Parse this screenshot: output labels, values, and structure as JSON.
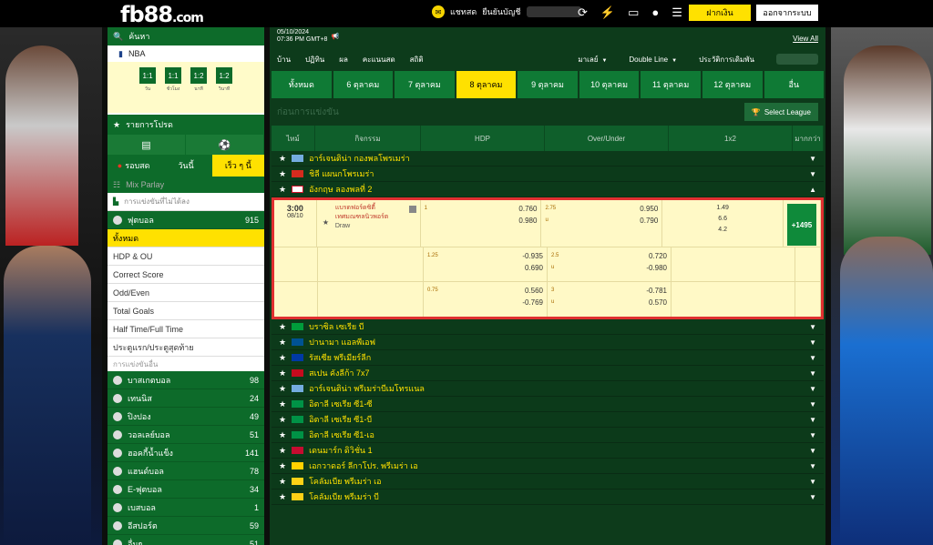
{
  "brand": {
    "logo_main": "fb88",
    "logo_domain": ".com",
    "accent": "#ffe100",
    "green": "#0d6b2a"
  },
  "topbar": {
    "chat_label": "แชทสด",
    "balance_label": "ยืนยันบัญชี",
    "deposit_label": "ฝากเงิน",
    "logout_label": "ออกจากระบบ"
  },
  "sidebar": {
    "search_label": "ค้นหา",
    "nba_label": "NBA",
    "scores": [
      {
        "num": "1:1",
        "lab": "วัน"
      },
      {
        "num": "1:1",
        "lab": "ชั่วโมง"
      },
      {
        "num": "1:2",
        "lab": "นาที"
      },
      {
        "num": "1:2",
        "lab": "วินาที"
      }
    ],
    "favorites_label": "รายการโปรด",
    "tabs": {
      "live": "รอบสด",
      "today": "วันนี้",
      "early": "เร็ว ๆ นี้"
    },
    "mix_parlay": "Mix Parlay",
    "mix_sub": "การแข่งขันที่ไม่ได้ลง",
    "football": {
      "label": "ฟุตบอล",
      "count": "915"
    },
    "sub_items": [
      "ทั้งหมด",
      "HDP & OU",
      "Correct Score",
      "Odd/Even",
      "Total Goals",
      "Half Time/Full Time",
      "ประตูแรก/ประตูสุดท้าย"
    ],
    "other_label": "การแข่งขันอื่น",
    "sports": [
      {
        "label": "บาสเกตบอล",
        "count": "98"
      },
      {
        "label": "เทนนิส",
        "count": "24"
      },
      {
        "label": "ปิงปอง",
        "count": "49"
      },
      {
        "label": "วอลเลย์บอล",
        "count": "51"
      },
      {
        "label": "ฮอคกี้น้ำแข็ง",
        "count": "141"
      },
      {
        "label": "แฮนด์บอล",
        "count": "78"
      },
      {
        "label": "E-ฟุตบอล",
        "count": "34"
      },
      {
        "label": "เบสบอล",
        "count": "1"
      },
      {
        "label": "อีสปอร์ต",
        "count": "59"
      },
      {
        "label": "อื่นๆ",
        "count": "51"
      }
    ]
  },
  "main": {
    "date": "05/10/2024",
    "time": "07:36 PM GMT+8",
    "view_all": "View All",
    "filters": [
      "บ้าน",
      "ปฏิทิน",
      "ผล",
      "คะแนนสด",
      "สถิติ"
    ],
    "market_label": "มาเลย์",
    "line_label": "Double Line",
    "history_label": "ประวัติการเดิมพัน",
    "day_tabs": [
      "ทั้งหมด",
      "6 ตุลาคม",
      "7 ตุลาคม",
      "8 ตุลาคม",
      "9 ตุลาคม",
      "10 ตุลาคม",
      "11 ตุลาคม",
      "12 ตุลาคม",
      "อื่น"
    ],
    "league_title": "ก่อนการแข่งขัน",
    "select_league": "Select League",
    "columns": [
      "ไทม์",
      "กิจกรรม",
      "HDP",
      "Over/Under",
      "1x2",
      "มากกว่า"
    ],
    "leagues_top": [
      {
        "name": "อาร์เจนติน่า กองพลโพรเมร่า",
        "flag": "#74acdf"
      },
      {
        "name": "ชิลี แผนกโพรเมร่า",
        "flag": "#d52b1e"
      },
      {
        "name": "อังกฤษ ลองพลที่ 2",
        "flag": "#cf142b"
      }
    ],
    "match": {
      "time": "3:00",
      "date": "08/10",
      "home": "แบรดฟอร์ดซิตี้",
      "away": "เทศมณฑลนิวพอร์ต",
      "draw": "Draw",
      "more": "+1495",
      "rows": [
        {
          "hdp_h": "1",
          "hdp_o1": "0.760",
          "hdp_o2": "0.980",
          "ou_h": "2.75",
          "ou_o1": "0.950",
          "ou_u": "u",
          "ou_o2": "0.790",
          "x1": "1.49",
          "x2": "6.6",
          "x3": "4.2"
        },
        {
          "hdp_h": "1.25",
          "hdp_o1": "-0.935",
          "hdp_o2": "0.690",
          "ou_h": "2.5",
          "ou_o1": "0.720",
          "ou_u": "u",
          "ou_o2": "-0.980"
        },
        {
          "hdp_h": "0.75",
          "hdp_o1": "0.560",
          "hdp_o2": "-0.769",
          "ou_h": "3",
          "ou_o1": "-0.781",
          "ou_u": "u",
          "ou_o2": "0.570"
        }
      ]
    },
    "leagues_bottom": [
      {
        "name": "บราซิล เซเรีย บี",
        "flag": "#009c3b"
      },
      {
        "name": "ปานามา แอลพีเอฟ",
        "flag": "#005293"
      },
      {
        "name": "รัสเซีย พรีเมียร์ลีก",
        "flag": "#0039a6"
      },
      {
        "name": "สเปน คังลีก้า 7x7",
        "flag": "#c60b1e"
      },
      {
        "name": "อาร์เจนติน่า พรีเมร่าบีเมโทรแนล",
        "flag": "#74acdf"
      },
      {
        "name": "อิตาลี เซเรีย ซี1-ซี",
        "flag": "#009246"
      },
      {
        "name": "อิตาลี เซเรีย ซี1-บี",
        "flag": "#009246"
      },
      {
        "name": "อิตาลี เซเรีย ซี1-เอ",
        "flag": "#009246"
      },
      {
        "name": "เดนมาร์ก ดิวิชั่น 1",
        "flag": "#c60c30"
      },
      {
        "name": "เอกวาดอร์ ลีกาโปร. พรีเมร่า เอ",
        "flag": "#ffd100"
      },
      {
        "name": "โคลัมเบีย พรีเมร่า เอ",
        "flag": "#fcd116"
      },
      {
        "name": "โคลัมเบีย พรีเมร่า บี",
        "flag": "#fcd116"
      }
    ]
  }
}
